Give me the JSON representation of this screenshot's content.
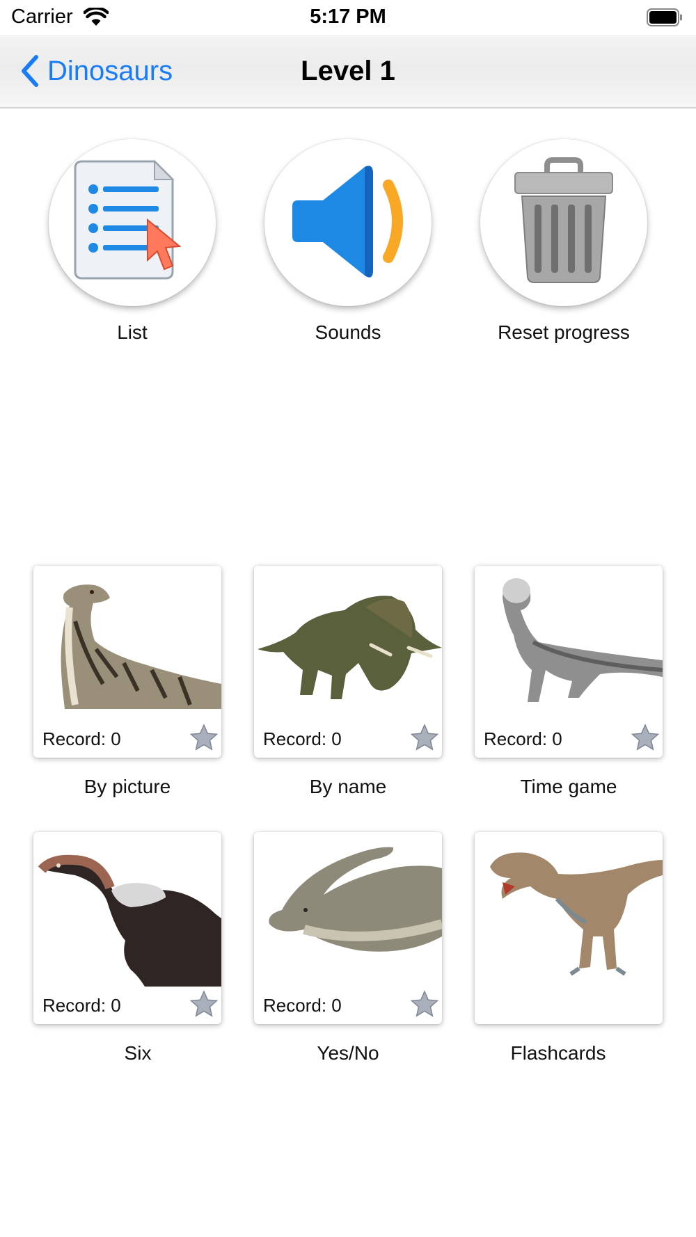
{
  "status_bar": {
    "carrier": "Carrier",
    "time": "5:17 PM"
  },
  "nav": {
    "back_label": "Dinosaurs",
    "title": "Level 1"
  },
  "tools": [
    {
      "label": "List",
      "icon": "list-document-icon"
    },
    {
      "label": "Sounds",
      "icon": "speaker-icon"
    },
    {
      "label": "Reset progress",
      "icon": "trash-can-icon"
    }
  ],
  "games": [
    {
      "label": "By picture",
      "record": "Record: 0",
      "image": "raptor-dinosaur-image"
    },
    {
      "label": "By name",
      "record": "Record: 0",
      "image": "triceratops-image"
    },
    {
      "label": "Time game",
      "record": "Record: 0",
      "image": "pachycephalosaurus-image"
    },
    {
      "label": "Six",
      "record": "Record: 0",
      "image": "feathered-dinosaur-image"
    },
    {
      "label": "Yes/No",
      "record": "Record: 0",
      "image": "parasaurolophus-image"
    },
    {
      "label": "Flashcards",
      "image": "theropod-dinosaur-image"
    }
  ],
  "colors": {
    "accent": "#1a7cf5",
    "speaker_blue": "#1e88e5",
    "sound_wave": "#f9a825",
    "star": "#a9b0bc"
  }
}
